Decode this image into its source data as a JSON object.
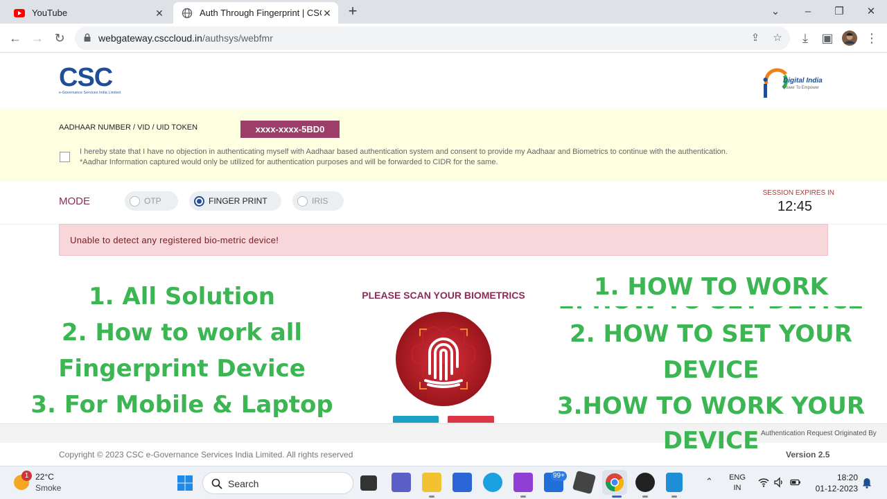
{
  "browser": {
    "tabs": [
      {
        "title": "YouTube",
        "active": false
      },
      {
        "title": "Auth Through Fingerprint | CSC",
        "active": true
      }
    ],
    "url_host": "webgateway.csccloud.in",
    "url_path": "/authsys/webfmr",
    "new_tab": "+",
    "minimize": "–",
    "maximize": "❐",
    "close": "✕"
  },
  "header": {
    "csc_letters": "CSC",
    "csc_tagline": "e-Governance Services India Limited",
    "digital_india": "Digital India",
    "digital_india_tagline": "Power To Empower"
  },
  "consent": {
    "aadhaar_label": "AADHAAR NUMBER / VID / UID TOKEN",
    "aadhaar_value": "xxxx-xxxx-5BD0",
    "text_line1": "I hereby state that I have no objection in authenticating myself with Aadhaar based authentication system and consent to provide my Aadhaar and Biometrics to continue with the authentication.",
    "text_line2": "*Aadhar Information captured would only be utilized for authentication purposes and will be forwarded to CIDR for the same."
  },
  "mode": {
    "label": "MODE",
    "options": [
      {
        "label": "OTP",
        "state": "disabled"
      },
      {
        "label": "FINGER PRINT",
        "state": "selected"
      },
      {
        "label": "IRIS",
        "state": "disabled"
      }
    ],
    "session_label": "SESSION EXPIRES IN",
    "session_time": "12:45"
  },
  "alert": {
    "text": "Unable to detect any registered bio-metric device!"
  },
  "overlay": {
    "left_lines": [
      "1. All Solution",
      "2. How to work all",
      "Fingerprint Device",
      "3. For Mobile & Laptop"
    ],
    "right_lines": [
      "1. HOW TO WORK",
      "2. HOW TO SET YOUR",
      "DEVICE",
      "3.HOW TO WORK YOUR"
    ],
    "right_partial": "2. HOW TO SET DEVICE",
    "bottom_line": "DEVICE"
  },
  "scan": {
    "label": "PLEASE SCAN YOUR BIOMETRICS"
  },
  "footer": {
    "note": "Authentication Request Originated By",
    "copyright": "Copyright © 2023 CSC e-Governance Services India Limited. All rights reserved",
    "version": "Version 2.5"
  },
  "taskbar": {
    "weather_badge": "1",
    "weather_temp": "22°C",
    "weather_desc": "Smoke",
    "search_label": "Search",
    "badge_count": "99+",
    "lang_top": "ENG",
    "lang_bottom": "IN",
    "time": "18:20",
    "date": "01-12-2023"
  }
}
